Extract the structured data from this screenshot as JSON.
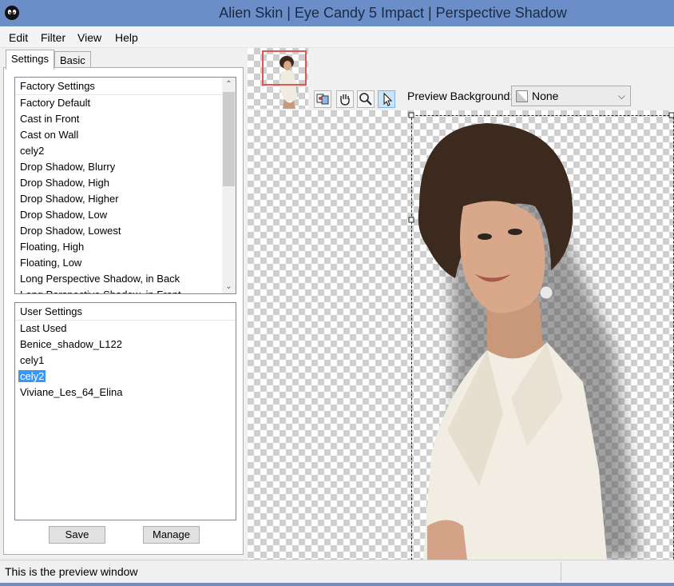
{
  "window": {
    "title": "Alien Skin | Eye Candy 5 Impact | Perspective Shadow"
  },
  "menu": [
    "Edit",
    "Filter",
    "View",
    "Help"
  ],
  "tabs": {
    "settings": "Settings",
    "basic": "Basic"
  },
  "factory_settings": {
    "header": "Factory Settings",
    "items": [
      "Factory Default",
      "Cast in Front",
      "Cast on Wall",
      "cely2",
      "Drop Shadow, Blurry",
      "Drop Shadow, High",
      "Drop Shadow, Higher",
      "Drop Shadow, Low",
      "Drop Shadow, Lowest",
      "Floating, High",
      "Floating, Low",
      "Long Perspective Shadow, in Back",
      "Long Perspective Shadow, in Front"
    ]
  },
  "user_settings": {
    "header": "User Settings",
    "items": [
      "Last Used",
      "Benice_shadow_L122",
      "cely1",
      "cely2",
      "Viviane_Les_64_Elina"
    ],
    "selected_index": 3
  },
  "buttons": {
    "save": "Save",
    "manage": "Manage"
  },
  "toolbar": {
    "tools": [
      "preview-toggle-icon",
      "hand-icon",
      "zoom-icon",
      "pointer-icon"
    ],
    "active_tool": "pointer-icon"
  },
  "preview_background": {
    "label": "Preview Background:",
    "value": "None"
  },
  "status": {
    "text": "This is the preview window"
  },
  "colors": {
    "titlebar": "#6b8ec8",
    "selection": "#3399ff",
    "thumb_border": "#e05555"
  }
}
